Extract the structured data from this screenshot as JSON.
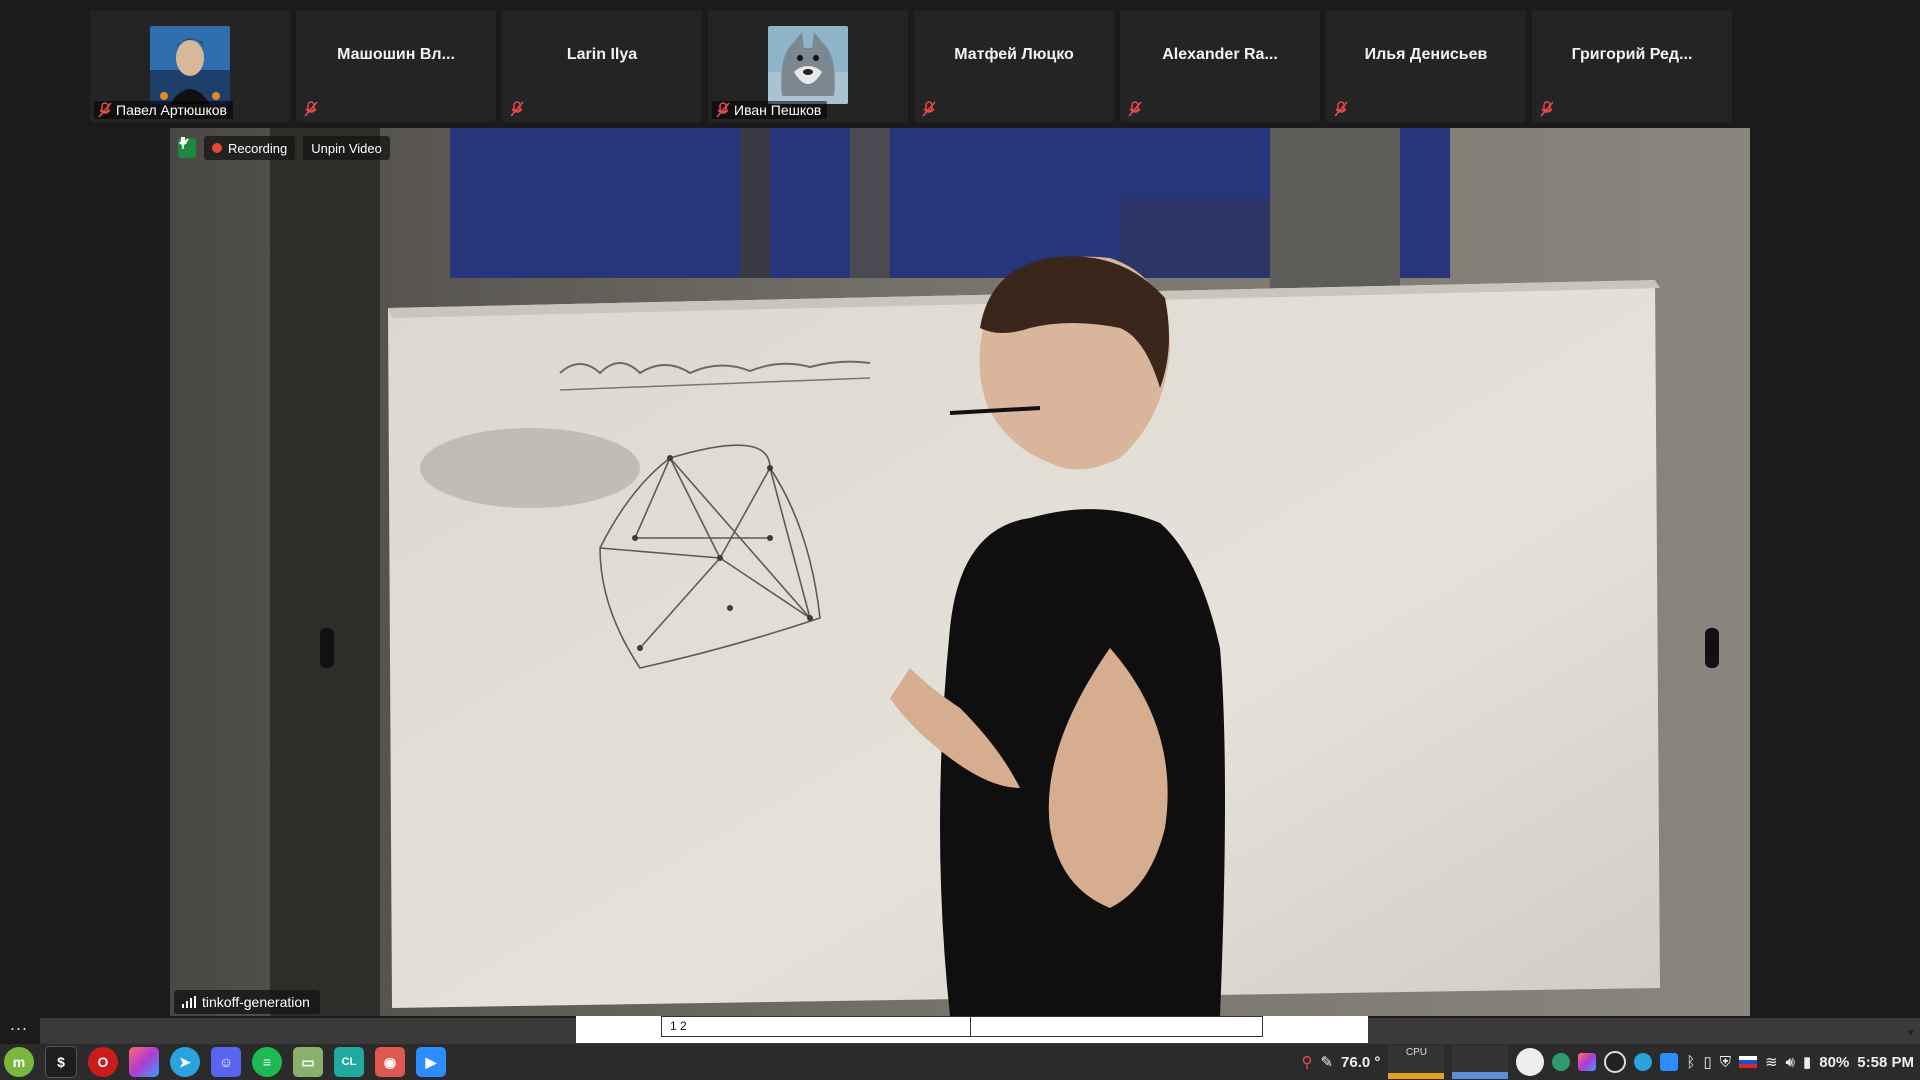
{
  "participants": [
    {
      "name": "Павел Артюшков",
      "has_video": true,
      "avatar": "male-portrait-avatar"
    },
    {
      "name": "Машошин Вл...",
      "has_video": false
    },
    {
      "name": "Larin Ilya",
      "has_video": false
    },
    {
      "name": "Иван Пешков",
      "has_video": true,
      "avatar": "wolf-avatar"
    },
    {
      "name": "Матфей Люцко",
      "has_video": false
    },
    {
      "name": "Alexander Ra...",
      "has_video": false
    },
    {
      "name": "Илья Денисьев",
      "has_video": false
    },
    {
      "name": "Григорий Ред...",
      "has_video": false
    }
  ],
  "video": {
    "recording_label": "Recording",
    "unpin_label": "Unpin Video",
    "speaker_name": "tinkoff-generation",
    "whiteboard_heading": "Матчинговые подграфы"
  },
  "menu": {
    "more_label": "..."
  },
  "workspace": {
    "label": "1  2"
  },
  "taskbar": {
    "apps": [
      {
        "name": "mint-menu-icon",
        "color": "#7bb73e"
      },
      {
        "name": "terminal-icon",
        "color": "#1e1e1e"
      },
      {
        "name": "opera-icon",
        "color": "#cc1b1b"
      },
      {
        "name": "pycharm-icon",
        "color": "#b03bd1"
      },
      {
        "name": "telegram-icon",
        "color": "#2aa3df"
      },
      {
        "name": "discord-icon",
        "color": "#5865f2"
      },
      {
        "name": "spotify-icon",
        "color": "#1db954"
      },
      {
        "name": "files-icon",
        "color": "#8ab16b"
      },
      {
        "name": "clion-icon",
        "color": "#21a89f"
      },
      {
        "name": "bug-tracker-icon",
        "color": "#e0574f"
      },
      {
        "name": "zoom-icon",
        "color": "#2d8cff"
      }
    ],
    "temperature": "76.0 °",
    "cpu_label": "CPU",
    "battery": "80%",
    "clock": "5:58 PM"
  },
  "colors": {
    "recording": "#e2483d",
    "shield": "#1f8a3f",
    "accent": "#2d8cff"
  }
}
